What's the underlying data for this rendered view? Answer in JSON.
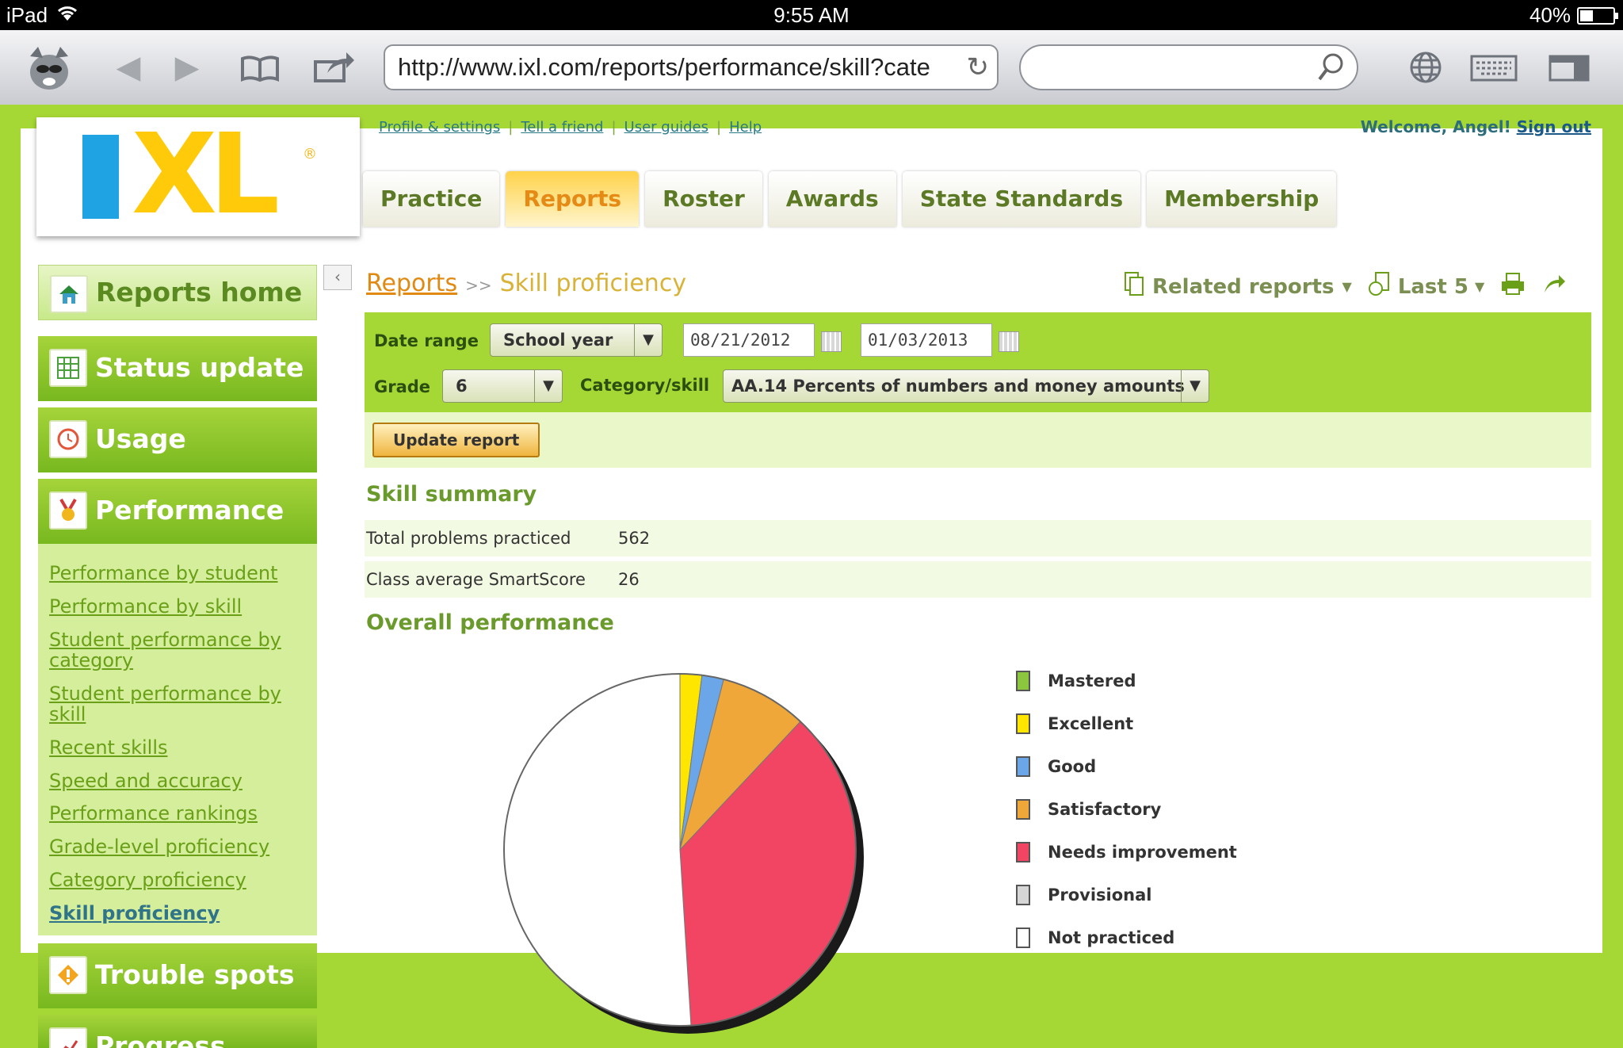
{
  "status_bar": {
    "device": "iPad",
    "time": "9:55 AM",
    "battery": "40%"
  },
  "browser": {
    "url": "http://www.ixl.com/reports/performance/skill?cate",
    "search_placeholder": ""
  },
  "header": {
    "logo_text": "IXL",
    "top_links": [
      "Profile & settings",
      "Tell a friend",
      "User guides",
      "Help"
    ],
    "welcome": "Welcome, Angel!",
    "sign_out": "Sign out",
    "tabs": [
      "Practice",
      "Reports",
      "Roster",
      "Awards",
      "State Standards",
      "Membership"
    ],
    "active_tab": "Reports"
  },
  "sidebar": {
    "home": "Reports home",
    "sections": [
      "Status update",
      "Usage",
      "Performance",
      "Trouble spots",
      "Progress"
    ],
    "performance_links": [
      "Performance by student",
      "Performance by skill",
      "Student performance by category",
      "Student performance by skill",
      "Recent skills",
      "Speed and accuracy",
      "Performance rankings",
      "Grade-level proficiency",
      "Category proficiency",
      "Skill proficiency"
    ],
    "current_link": "Skill proficiency"
  },
  "breadcrumb": {
    "parent": "Reports",
    "separator": ">>",
    "current": "Skill proficiency"
  },
  "tools": {
    "related": "Related reports",
    "last": "Last 5"
  },
  "filters": {
    "date_range_label": "Date range",
    "date_range_value": "School year",
    "start_date": "08/21/2012",
    "end_date": "01/03/2013",
    "grade_label": "Grade",
    "grade_value": "6",
    "category_label": "Category/skill",
    "category_value": "AA.14 Percents of numbers and money amounts",
    "update_button": "Update report"
  },
  "skill_summary": {
    "title": "Skill summary",
    "rows": [
      {
        "label": "Total problems practiced",
        "value": "562"
      },
      {
        "label": "Class average SmartScore",
        "value": "26"
      }
    ]
  },
  "overall_title": "Overall performance",
  "chart_data": {
    "type": "pie",
    "title": "Overall performance",
    "series": [
      {
        "name": "Mastered",
        "value": 0,
        "color": "#8cc63f"
      },
      {
        "name": "Excellent",
        "value": 2,
        "color": "#ffe600"
      },
      {
        "name": "Good",
        "value": 2,
        "color": "#6ba6e8"
      },
      {
        "name": "Satisfactory",
        "value": 8,
        "color": "#f0a73a"
      },
      {
        "name": "Needs improvement",
        "value": 37,
        "color": "#f14563"
      },
      {
        "name": "Provisional",
        "value": 0,
        "color": "#d6d6d6"
      },
      {
        "name": "Not practiced",
        "value": 51,
        "color": "#ffffff"
      }
    ],
    "legend_position": "right"
  }
}
